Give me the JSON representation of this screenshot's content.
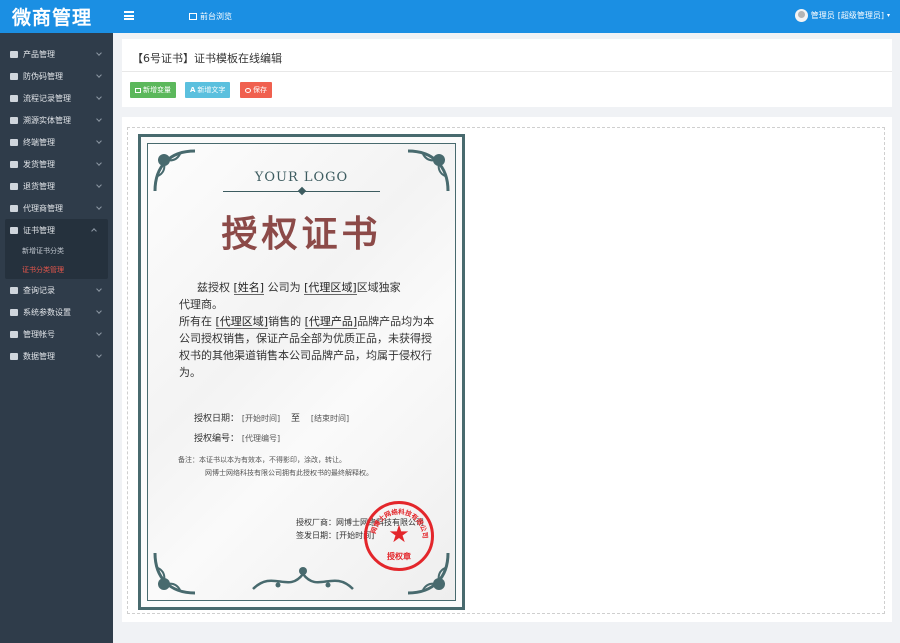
{
  "app": {
    "logo": "微商管理",
    "home_label": "前台浏览",
    "user_label": "管理员",
    "user_role": "[超级管理员]"
  },
  "sidebar": {
    "items": [
      {
        "label": "产品管理",
        "icon": "edit-icon"
      },
      {
        "label": "防伪码管理",
        "icon": "list-icon"
      },
      {
        "label": "流程记录管理",
        "icon": "tags-icon"
      },
      {
        "label": "溯源实体管理",
        "icon": "retweet-icon"
      },
      {
        "label": "终端管理",
        "icon": "grid-icon"
      },
      {
        "label": "发货管理",
        "icon": "truck-icon"
      },
      {
        "label": "退货管理",
        "icon": "minus-circle-icon"
      },
      {
        "label": "代理商管理",
        "icon": "users-icon"
      }
    ],
    "expanded": {
      "label": "证书管理",
      "icon": "certificate-icon",
      "children": [
        {
          "label": "新增证书分类",
          "active": false
        },
        {
          "label": "证书分类管理",
          "active": true
        }
      ]
    },
    "items_after": [
      {
        "label": "查询记录",
        "icon": "search-icon"
      },
      {
        "label": "系统参数设置",
        "icon": "wrench-icon"
      },
      {
        "label": "管理帐号",
        "icon": "lock-icon"
      },
      {
        "label": "数据管理",
        "icon": "table-icon"
      }
    ]
  },
  "page": {
    "title": "【6号证书】证书模板在线编辑",
    "buttons": {
      "add_var": "新增变量",
      "add_text": "新增文字",
      "save": "保存"
    }
  },
  "certificate": {
    "logo_text": "YOUR LOGO",
    "title": "授权证书",
    "line1_a": "兹授权",
    "name_ph": "[姓名]",
    "line1_b": "公司为",
    "region_ph": "[代理区域]",
    "line1_c": "区域独家",
    "line2": "代理商。",
    "line3_a": "所有在",
    "region_ph2": "[代理区域]",
    "line3_b": "销售的",
    "product_ph": "[代理产品]",
    "line3_c": "品牌产品均为本公司授权销售，保证产品全部为优质正品，未获得授权书的其他渠道销售本公司品牌产品，均属于侵权行为。",
    "date_label": "授权日期：",
    "start_ph": "[开始时间]",
    "to": "至",
    "end_ph": "[结束时间]",
    "code_label": "授权编号：",
    "code_ph": "[代理编号]",
    "note1": "备注：本证书以本为有效本，不得影印，涂改，转让。",
    "note2": "网博士网络科技有限公司拥有此授权书的最终解释权。",
    "issuer_label": "授权厂商：网博士网络科技有限公司",
    "issue_date": "签发日期：[开始时间]",
    "stamp_text": "授权章",
    "stamp_ring": "网博士网络科技有限公司"
  },
  "colors": {
    "topbar": "#1b8fe3",
    "sidebar": "#2f3c4a",
    "active": "#e9574c",
    "cert_border": "#486a6e",
    "cert_title": "#8c4a48",
    "stamp": "#e3262b"
  }
}
